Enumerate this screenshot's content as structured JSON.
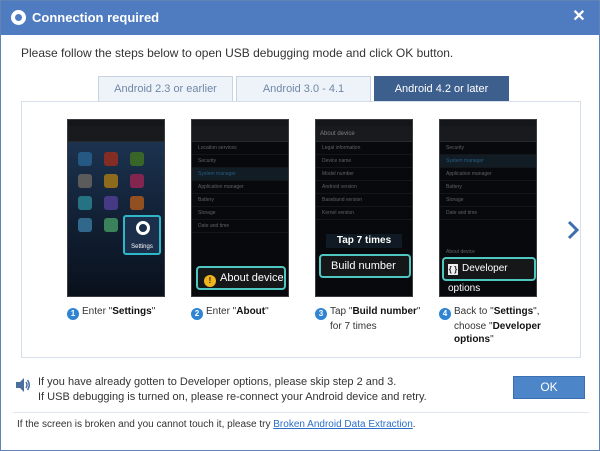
{
  "window": {
    "title": "Connection required",
    "close_glyph": "✕"
  },
  "instruction": "Please follow the steps below to open USB debugging mode and click OK button.",
  "tabs": [
    {
      "label": "Android 2.3 or earlier",
      "active": false
    },
    {
      "label": "Android 3.0 - 4.1",
      "active": false
    },
    {
      "label": "Android 4.2 or later",
      "active": true
    }
  ],
  "steps": [
    {
      "number": "1",
      "screen_label": "Settings",
      "caption_pre": "Enter \"",
      "caption_bold": "Settings",
      "caption_post": "\"",
      "caption_line2": ""
    },
    {
      "number": "2",
      "screen_callout": "About device",
      "caption_pre": "Enter \"",
      "caption_bold": "About",
      "caption_post": "\"",
      "caption_line2": ""
    },
    {
      "number": "3",
      "screen_head": "About device",
      "screen_bubble": "Tap 7 times",
      "screen_callout": "Build number",
      "caption_pre": "Tap \"",
      "caption_bold": "Build number",
      "caption_post": "\"",
      "caption_line2": "for 7 times"
    },
    {
      "number": "4",
      "screen_callout": "Developer options",
      "caption_pre": "Back to \"",
      "caption_bold": "Settings",
      "caption_post": "\",",
      "caption_line2_pre": "choose \"",
      "caption_line2_bold": "Developer options",
      "caption_line2_post": "\""
    }
  ],
  "phone_text": {
    "step2_rows": [
      "Location services",
      "Security",
      "System manager",
      "Application manager",
      "Battery",
      "Storage",
      "Date and time"
    ],
    "step3_rows": [
      "Legal information",
      "Device name",
      "Model number",
      "Android version",
      "Baseband version",
      "Kernel version"
    ],
    "step4_rows": [
      "Security",
      "System manager",
      "Application manager",
      "Battery",
      "Storage",
      "Date and time",
      "About device"
    ]
  },
  "note_line1": "If you have already gotten to Developer options, please skip step 2 and 3.",
  "note_line2": "If USB debugging is turned on, please re-connect your Android device and retry.",
  "ok_label": "OK",
  "footer_text": "If the screen is broken and you cannot touch it, please try ",
  "footer_link": "Broken Android Data Extraction",
  "footer_end": ".",
  "colors": {
    "titlebar": "#4f7cc0",
    "active_tab": "#3d5f8d",
    "ok_button": "#4c85c8",
    "callout_border": "#4fc6bf",
    "link": "#2b6fc8"
  },
  "icons": {
    "title": "connection-icon",
    "close": "close-icon",
    "next": "chevron-right-icon",
    "note": "speaker-icon"
  }
}
